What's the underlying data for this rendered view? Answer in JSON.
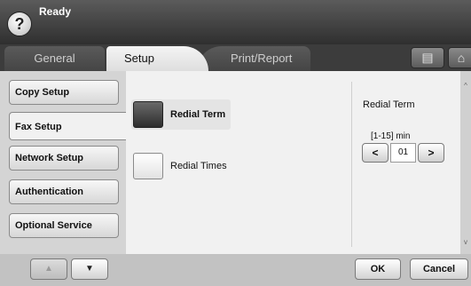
{
  "status": {
    "text": "Ready",
    "help_icon": "question-mark-icon"
  },
  "tabs": [
    {
      "label": "General"
    },
    {
      "label": "Setup"
    },
    {
      "label": "Print/Report"
    }
  ],
  "tab_icons": [
    "job-status-icon",
    "home-icon"
  ],
  "sidebar": {
    "items": [
      {
        "label": "Copy Setup"
      },
      {
        "label": "Fax Setup"
      },
      {
        "label": "Network Setup"
      },
      {
        "label": "Authentication"
      },
      {
        "label": "Optional Service"
      }
    ],
    "active": "Fax Setup"
  },
  "main": {
    "options": [
      {
        "label": "Redial Term",
        "selected": true
      },
      {
        "label": "Redial Times",
        "selected": false
      }
    ],
    "detail": {
      "title": "Redial Term",
      "range_label": "[1-15] min",
      "value": "01",
      "decrement_glyph": "<",
      "increment_glyph": ">"
    }
  },
  "bottom": {
    "ok_label": "OK",
    "cancel_label": "Cancel",
    "page_up_glyph": "▲",
    "page_down_glyph": "▼"
  },
  "colors": {
    "background": "#d9d9d9",
    "topbar": "#3c3c3c",
    "selected_option": "#2d2d2d"
  }
}
